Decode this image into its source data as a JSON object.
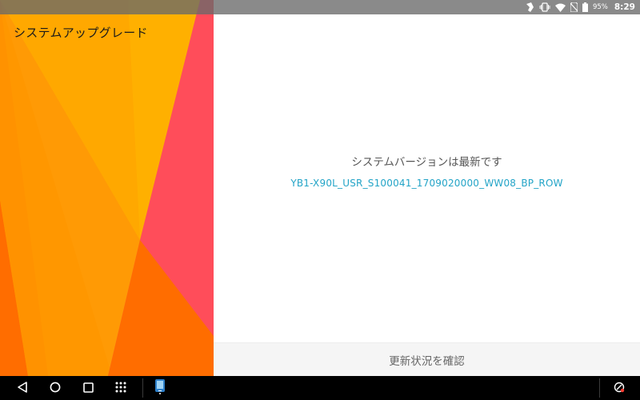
{
  "app": {
    "title": "システムアップグレード"
  },
  "status_bar": {
    "battery_percent": "95%",
    "time": "8:29",
    "icons": [
      "silent-mode-icon",
      "vibrate-icon",
      "wifi-icon",
      "no-sim-icon",
      "battery-icon"
    ]
  },
  "main": {
    "status_text": "システムバージョンは最新です",
    "version": "YB1-X90L_USR_S100041_1709020000_WW08_BP_ROW",
    "check_button_label": "更新状況を確認"
  },
  "nav_bar": {
    "buttons": [
      "back-icon",
      "home-icon",
      "recents-icon",
      "app-drawer-icon",
      "recent-app-icon",
      "smart-assist-icon"
    ]
  },
  "colors": {
    "accent": "#23a4c7",
    "wallpaper_yellow": "#ffb000",
    "wallpaper_orange": "#ff9700",
    "wallpaper_deep_orange": "#ff6d00",
    "wallpaper_pink": "#ff4d5a"
  }
}
